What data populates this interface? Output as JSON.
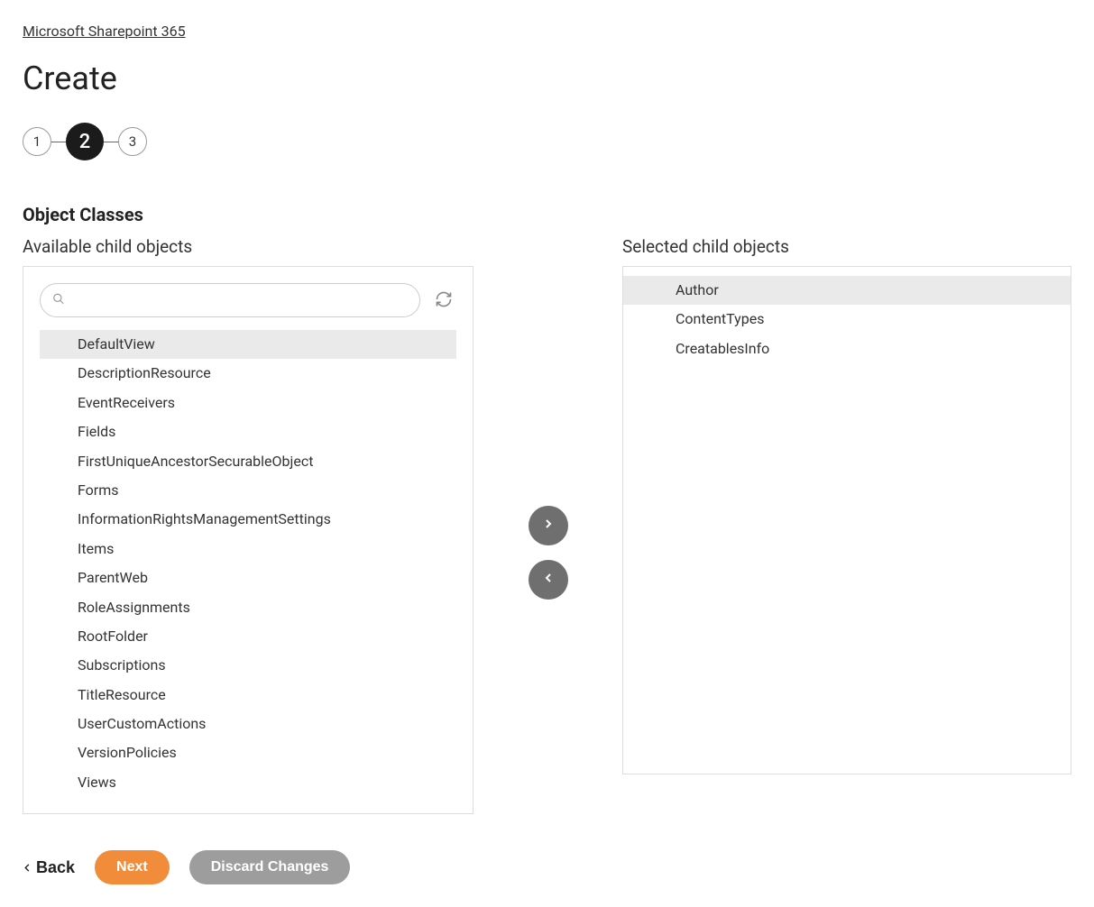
{
  "breadcrumb": {
    "label": "Microsoft Sharepoint 365"
  },
  "page": {
    "title": "Create"
  },
  "stepper": {
    "steps": [
      "1",
      "2",
      "3"
    ],
    "active_index": 1
  },
  "section": {
    "heading": "Object Classes",
    "available_label": "Available child objects",
    "selected_label": "Selected child objects"
  },
  "search": {
    "value": "",
    "placeholder": ""
  },
  "available_items": [
    {
      "label": "DefaultView",
      "highlighted": true
    },
    {
      "label": "DescriptionResource",
      "highlighted": false
    },
    {
      "label": "EventReceivers",
      "highlighted": false
    },
    {
      "label": "Fields",
      "highlighted": false
    },
    {
      "label": "FirstUniqueAncestorSecurableObject",
      "highlighted": false
    },
    {
      "label": "Forms",
      "highlighted": false
    },
    {
      "label": "InformationRightsManagementSettings",
      "highlighted": false
    },
    {
      "label": "Items",
      "highlighted": false
    },
    {
      "label": "ParentWeb",
      "highlighted": false
    },
    {
      "label": "RoleAssignments",
      "highlighted": false
    },
    {
      "label": "RootFolder",
      "highlighted": false
    },
    {
      "label": "Subscriptions",
      "highlighted": false
    },
    {
      "label": "TitleResource",
      "highlighted": false
    },
    {
      "label": "UserCustomActions",
      "highlighted": false
    },
    {
      "label": "VersionPolicies",
      "highlighted": false
    },
    {
      "label": "Views",
      "highlighted": false
    }
  ],
  "selected_items": [
    {
      "label": "Author",
      "highlighted": true
    },
    {
      "label": "ContentTypes",
      "highlighted": false
    },
    {
      "label": "CreatablesInfo",
      "highlighted": false
    }
  ],
  "footer": {
    "back_label": "Back",
    "next_label": "Next",
    "discard_label": "Discard Changes"
  }
}
